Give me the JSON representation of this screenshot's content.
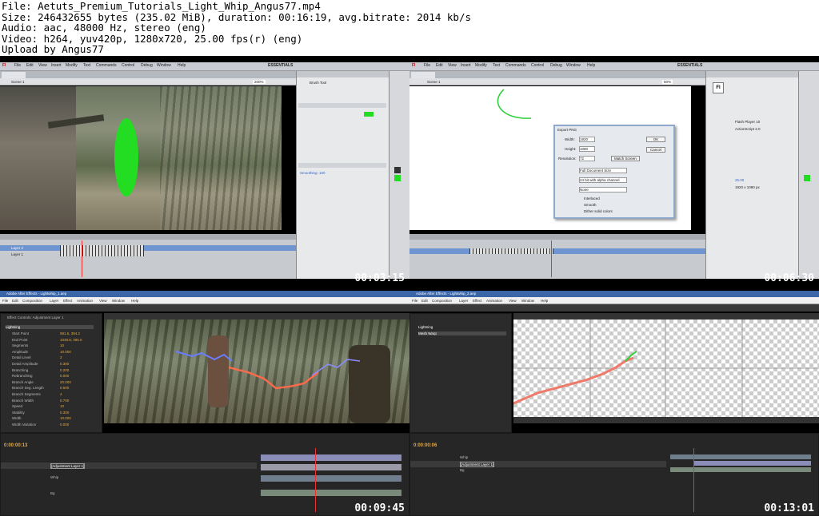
{
  "file_info": {
    "lines": [
      "File: Aetuts_Premium_Tutorials_Light_Whip_Angus77.mp4",
      "Size: 246432655 bytes (235.02 MiB), duration: 00:16:19, avg.bitrate: 2014 kb/s",
      "Audio: aac, 48000 Hz, stereo (eng)",
      "Video: h264, yuv420p, 1280x720, 25.00 fps(r) (eng)",
      "Upload by Angus77"
    ]
  },
  "thumbnails": [
    {
      "timestamp": "00:03:15",
      "app": "Flash",
      "scene": "Scene 1",
      "zoom": "200%",
      "essentials": "ESSENTIALS",
      "layers": [
        "Layer 2",
        "Layer 1"
      ]
    },
    {
      "timestamp": "00:06:30",
      "app": "Flash",
      "scene": "Scene 1",
      "zoom": "50%",
      "essentials": "ESSENTIALS",
      "dialog": {
        "title": "Export PNG",
        "width": "1920",
        "height": "1080",
        "resolution": "72",
        "include": "Full Document Size",
        "colors": "24 bit with alpha channel",
        "filter": "None",
        "ok": "OK",
        "cancel": "Cancel",
        "match_screen": "Match Screen",
        "checks": [
          "Interlaced",
          "Smooth",
          "Dither solid colors"
        ]
      },
      "profile": {
        "player": "Flash Player 10",
        "script": "ActionScript 2.0",
        "fps": "25.00",
        "size": "1920 x 1080 px"
      }
    },
    {
      "timestamp": "00:09:45",
      "app": "After Effects",
      "title": "Adobe After Effects - Lightwhip_1.aep",
      "effect_panel": "Effect Controls: Adjustment Layer 1",
      "effect": "Lightning",
      "params": [
        [
          "Start Point",
          "981.6, 394.2"
        ],
        [
          "End Point",
          "1048.8, 395.0"
        ],
        [
          "Segments",
          "10"
        ],
        [
          "Amplitude",
          "10.000"
        ],
        [
          "Detail Level",
          "2"
        ],
        [
          "Detail Amplitude",
          "0.300"
        ],
        [
          "Branching",
          "0.200"
        ],
        [
          "Rebranching",
          "0.000"
        ],
        [
          "Branch Angle",
          "20.000"
        ],
        [
          "Branch Seg. Length",
          "0.500"
        ],
        [
          "Branch Segments",
          "4"
        ],
        [
          "Branch Width",
          "0.700"
        ],
        [
          "Speed",
          "10"
        ],
        [
          "Stability",
          "0.300"
        ],
        [
          "Width",
          "10.000"
        ],
        [
          "Width Variation",
          "0.000"
        ]
      ],
      "timecode": "0:00:00:13",
      "layers": [
        "[Adjustment Layer 1]",
        "Whip",
        "Bg"
      ],
      "menus": [
        "File",
        "Edit",
        "Composition",
        "Layer",
        "Effect",
        "Animation",
        "View",
        "Window",
        "Help"
      ]
    },
    {
      "timestamp": "00:13:01",
      "app": "After Effects",
      "title": "Adobe After Effects - Lightwhip_2.aep",
      "effects": [
        "Lightning",
        "Mesh Warp"
      ],
      "timecode": "0:00:00:06",
      "layers": [
        "[Adjustment Layer 1]",
        "Whip",
        "Bg"
      ],
      "menus": [
        "File",
        "Edit",
        "Composition",
        "Layer",
        "Effect",
        "Animation",
        "View",
        "Window",
        "Help"
      ]
    }
  ],
  "flash_menus": [
    "File",
    "Edit",
    "View",
    "Insert",
    "Modify",
    "Text",
    "Commands",
    "Control",
    "Debug",
    "Window",
    "Help"
  ],
  "colors": {
    "flash_green": "#22dd22",
    "whip_green": "#2fd13c",
    "ae_orange": "#e8a83c",
    "stroke_red": "#f07a6a"
  }
}
